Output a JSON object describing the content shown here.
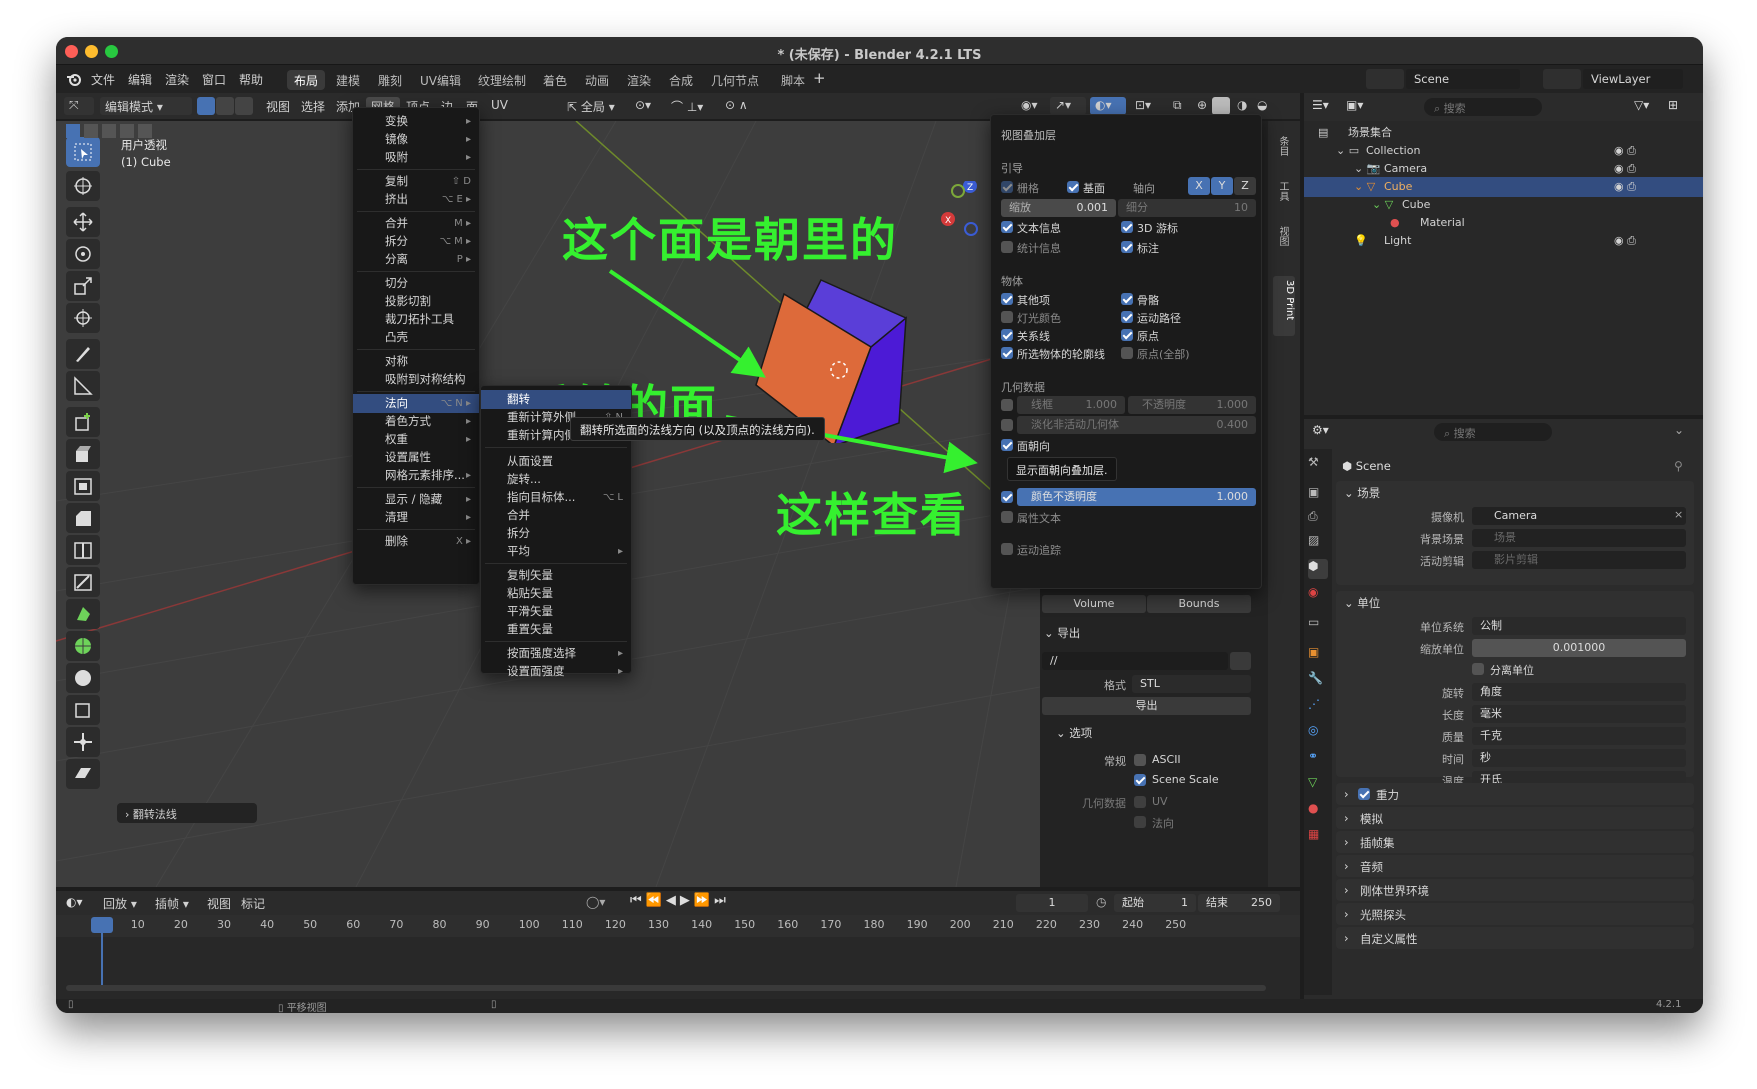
{
  "window": {
    "title": "* (未保存) - Blender 4.2.1 LTS"
  },
  "top_menu": [
    "文件",
    "编辑",
    "渲染",
    "窗口",
    "帮助"
  ],
  "workspace_tabs": [
    "布局",
    "建模",
    "雕刻",
    "UV编辑",
    "纹理绘制",
    "着色",
    "动画",
    "渲染",
    "合成",
    "几何节点",
    "脚本"
  ],
  "workspace_active": "布局",
  "viewport_header": {
    "mode": "编辑模式",
    "menus": [
      "视图",
      "选择",
      "添加",
      "网格",
      "顶点",
      "边",
      "面",
      "UV"
    ],
    "transform": "全局"
  },
  "viewport_info": {
    "view": "用户透视",
    "object": "(1) Cube"
  },
  "last_op": "翻转法线",
  "mesh_menu": {
    "items": [
      {
        "label": "变换",
        "shortcut": "",
        "sub": true
      },
      {
        "label": "镜像",
        "shortcut": "",
        "sub": true
      },
      {
        "label": "吸附",
        "shortcut": "",
        "sub": true
      },
      {
        "label": "复制",
        "shortcut": "⇧ D",
        "sub": false
      },
      {
        "label": "挤出",
        "shortcut": "⌥ E",
        "sub": true
      },
      {
        "label": "合并",
        "shortcut": "M",
        "sub": true
      },
      {
        "label": "拆分",
        "shortcut": "⌥ M",
        "sub": true
      },
      {
        "label": "分离",
        "shortcut": "P",
        "sub": true
      },
      {
        "label": "切分",
        "shortcut": "",
        "sub": false
      },
      {
        "label": "投影切割",
        "shortcut": "",
        "sub": false
      },
      {
        "label": "裁刀拓扑工具",
        "shortcut": "",
        "sub": false
      },
      {
        "label": "凸壳",
        "shortcut": "",
        "sub": false
      },
      {
        "label": "对称",
        "shortcut": "",
        "sub": false
      },
      {
        "label": "吸附到对称结构",
        "shortcut": "",
        "sub": false
      },
      {
        "label": "法向",
        "shortcut": "⌥ N",
        "sub": true
      },
      {
        "label": "着色方式",
        "shortcut": "",
        "sub": true
      },
      {
        "label": "权重",
        "shortcut": "",
        "sub": true
      },
      {
        "label": "设置属性",
        "shortcut": "",
        "sub": false
      },
      {
        "label": "网格元素排序...",
        "shortcut": "",
        "sub": true
      },
      {
        "label": "显示 / 隐藏",
        "shortcut": "",
        "sub": true
      },
      {
        "label": "清理",
        "shortcut": "",
        "sub": true
      },
      {
        "label": "删除",
        "shortcut": "X",
        "sub": true
      }
    ]
  },
  "normals_menu": {
    "items": [
      {
        "label": "翻转",
        "shortcut": "",
        "sub": false
      },
      {
        "label": "重新计算外侧",
        "shortcut": "⇧ N",
        "sub": false
      },
      {
        "label": "重新计算内侧",
        "shortcut": "",
        "sub": false
      },
      {
        "label": "从面设置",
        "shortcut": "",
        "sub": false
      },
      {
        "label": "旋转...",
        "shortcut": "",
        "sub": false
      },
      {
        "label": "指向目标体...",
        "shortcut": "⌥ L",
        "sub": false
      },
      {
        "label": "合并",
        "shortcut": "",
        "sub": false
      },
      {
        "label": "拆分",
        "shortcut": "",
        "sub": false
      },
      {
        "label": "平均",
        "shortcut": "",
        "sub": true
      },
      {
        "label": "复制矢量",
        "shortcut": "",
        "sub": false
      },
      {
        "label": "粘贴矢量",
        "shortcut": "",
        "sub": false
      },
      {
        "label": "平滑矢量",
        "shortcut": "",
        "sub": false
      },
      {
        "label": "重置矢量",
        "shortcut": "",
        "sub": false
      },
      {
        "label": "按面强度选择",
        "shortcut": "",
        "sub": true
      },
      {
        "label": "设置面强度",
        "shortcut": "",
        "sub": true
      }
    ],
    "tooltip": "翻转所选面的法线方向 (以及顶点的法线方向)."
  },
  "annotations": {
    "a1": "这个面是朝里的",
    "a2": "反转的面",
    "a3": "这样查看"
  },
  "overlay": {
    "title": "视图叠加层",
    "guides": "引导",
    "grid": "栅格",
    "floor": "基面",
    "axes": "轴向",
    "x": "X",
    "y": "Y",
    "z": "Z",
    "scale_label": "缩放",
    "scale_value": "0.001",
    "subdiv_label": "细分",
    "subdiv_value": "10",
    "text_info": "文本信息",
    "cursor3d": "3D 游标",
    "stats": "统计信息",
    "annotation": "标注",
    "objects": "物体",
    "extras": "其他项",
    "bones": "骨骼",
    "light_colors": "灯光颜色",
    "motion_paths": "运动路径",
    "relations": "关系线",
    "origins": "原点",
    "outline": "所选物体的轮廓线",
    "origins_all": "原点(全部)",
    "geometry": "几何数据",
    "wireframe": "线框",
    "wire_value": "1.000",
    "opacity": "不透明度",
    "opacity_value": "1.000",
    "fade": "淡化非活动几何体",
    "fade_value": "0.400",
    "face_orient": "面朝向",
    "tooltip": "显示面朝向叠加层.",
    "color_opacity": "颜色不透明度",
    "color_opacity_value": "1.000",
    "attr_text": "属性文本",
    "motion_tracking": "运动追踪"
  },
  "print3d": {
    "volume": "Volume",
    "bounds": "Bounds",
    "export": "导出",
    "path": "//",
    "format_label": "格式",
    "format": "STL",
    "export_btn": "导出",
    "options": "选项",
    "general": "常规",
    "ascii": "ASCII",
    "scene_scale": "Scene Scale",
    "geom_data": "几何数据",
    "uv": "UV",
    "normals": "法向",
    "side_tabs": [
      "条目",
      "工具",
      "视图",
      "3D Print"
    ]
  },
  "outliner": {
    "scene": "Scene",
    "view_layer": "ViewLayer",
    "search": "搜索",
    "rows": [
      {
        "label": "场景集合",
        "indent": 0
      },
      {
        "label": "Collection",
        "indent": 1
      },
      {
        "label": "Camera",
        "indent": 2
      },
      {
        "label": "Cube",
        "indent": 2
      },
      {
        "label": "Cube",
        "indent": 3
      },
      {
        "label": "Material",
        "indent": 4
      },
      {
        "label": "Light",
        "indent": 2
      }
    ]
  },
  "properties": {
    "search": "搜索",
    "scene_name": "Scene",
    "scene_section": "场景",
    "camera_label": "摄像机",
    "camera": "Camera",
    "bg_label": "背景场景",
    "bg": "场景",
    "clip_label": "活动剪辑",
    "clip": "影片剪辑",
    "units": "单位",
    "unit_system_label": "单位系统",
    "unit_system": "公制",
    "unit_scale_label": "缩放单位",
    "unit_scale": "0.001000",
    "separate": "分离单位",
    "rotation_label": "旋转",
    "rotation": "角度",
    "length_label": "长度",
    "length": "毫米",
    "mass_label": "质量",
    "mass": "千克",
    "time_label": "时间",
    "time": "秒",
    "temp_label": "温度",
    "temp": "开氏",
    "collapsed": [
      "重力",
      "模拟",
      "插帧集",
      "音频",
      "刚体世界环境",
      "光照探头",
      "自定义属性"
    ]
  },
  "timeline": {
    "menus": [
      "回放",
      "插帧",
      "视图",
      "标记"
    ],
    "current": "1",
    "start_label": "起始",
    "start": "1",
    "end_label": "结束",
    "end": "250",
    "ticks": [
      "1",
      "10",
      "20",
      "30",
      "40",
      "50",
      "60",
      "70",
      "80",
      "90",
      "100",
      "110",
      "120",
      "130",
      "140",
      "150",
      "160",
      "170",
      "180",
      "190",
      "200",
      "210",
      "220",
      "230",
      "240",
      "250"
    ]
  },
  "statusbar": {
    "pan": "平移视图",
    "version": "4.2.1"
  }
}
